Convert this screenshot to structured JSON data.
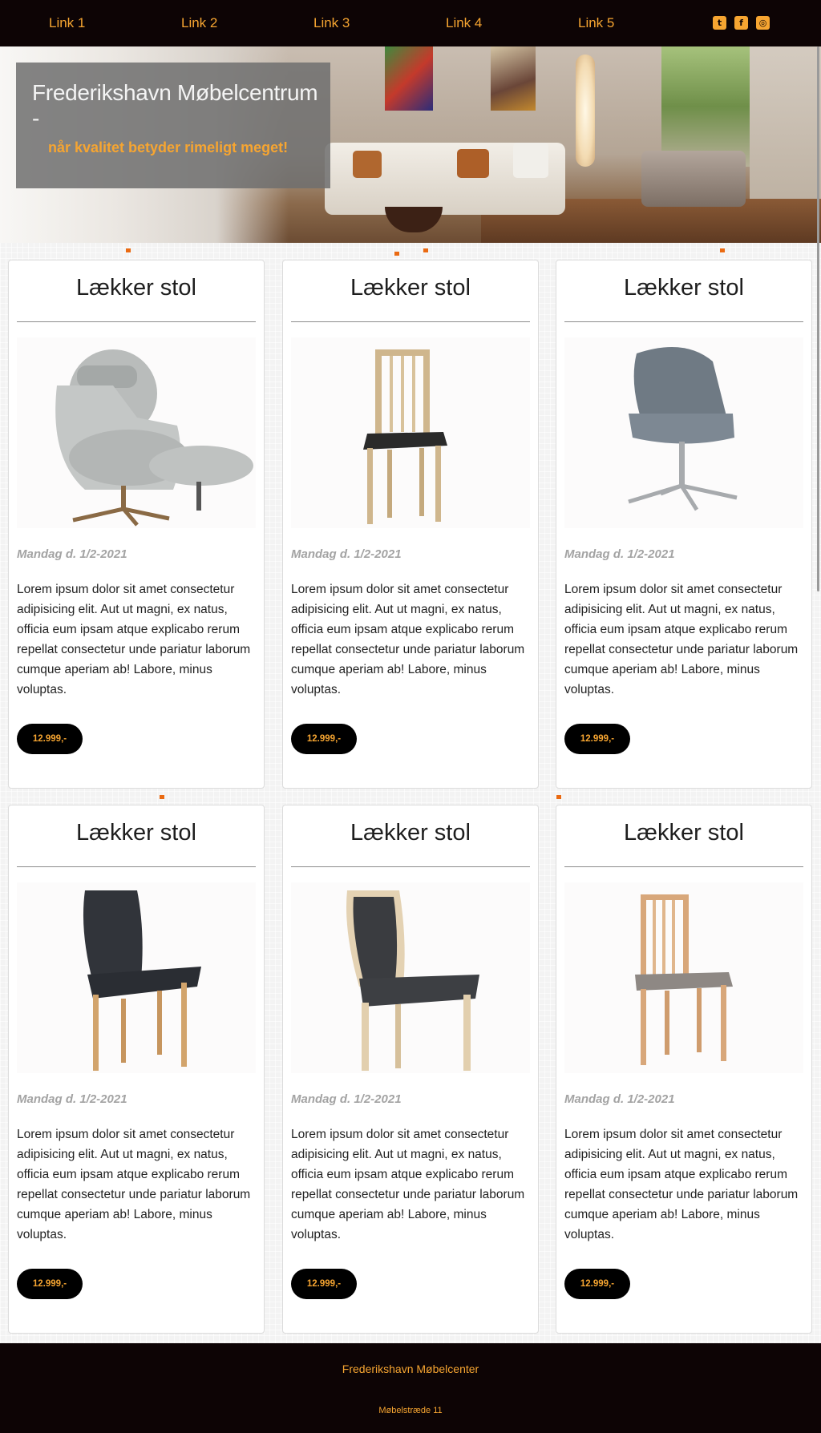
{
  "nav": {
    "links": [
      "Link 1",
      "Link 2",
      "Link 3",
      "Link 4",
      "Link 5"
    ],
    "social": [
      {
        "icon": "twitter-icon",
        "glyph": "t"
      },
      {
        "icon": "facebook-icon",
        "glyph": "f"
      },
      {
        "icon": "instagram-icon",
        "glyph": "◎"
      }
    ]
  },
  "hero": {
    "title": "Frederikshavn Møbelcentrum -",
    "subtitle": "når kvalitet betyder rimeligt meget!"
  },
  "products": [
    {
      "title": "Lækker stol",
      "image": "grey-wingback-armchair-with-footstool",
      "date": "Mandag d. 1/2-2021",
      "text": "Lorem ipsum dolor sit amet consectetur adipisicing elit. Aut ut magni, ex natus, officia eum ipsam atque explicabo rerum repellat consectetur unde pariatur laborum cumque aperiam ab! Labore, minus voluptas.",
      "price": "12.999,-"
    },
    {
      "title": "Lækker stol",
      "image": "oak-dining-chair-black-seat",
      "date": "Mandag d. 1/2-2021",
      "text": "Lorem ipsum dolor sit amet consectetur adipisicing elit. Aut ut magni, ex natus, officia eum ipsam atque explicabo rerum repellat consectetur unde pariatur laborum cumque aperiam ab! Labore, minus voluptas.",
      "price": "12.999,-"
    },
    {
      "title": "Lækker stol",
      "image": "grey-swivel-chair-chrome-base",
      "date": "Mandag d. 1/2-2021",
      "text": "Lorem ipsum dolor sit amet consectetur adipisicing elit. Aut ut magni, ex natus, officia eum ipsam atque explicabo rerum repellat consectetur unde pariatur laborum cumque aperiam ab! Labore, minus voluptas.",
      "price": "12.999,-"
    },
    {
      "title": "Lækker stol",
      "image": "black-leather-dining-chair",
      "date": "Mandag d. 1/2-2021",
      "text": "Lorem ipsum dolor sit amet consectetur adipisicing elit. Aut ut magni, ex natus, officia eum ipsam atque explicabo rerum repellat consectetur unde pariatur laborum cumque aperiam ab! Labore, minus voluptas.",
      "price": "12.999,-"
    },
    {
      "title": "Lækker stol",
      "image": "oak-chair-dark-upholstery",
      "date": "Mandag d. 1/2-2021",
      "text": "Lorem ipsum dolor sit amet consectetur adipisicing elit. Aut ut magni, ex natus, officia eum ipsam atque explicabo rerum repellat consectetur unde pariatur laborum cumque aperiam ab! Labore, minus voluptas.",
      "price": "12.999,-"
    },
    {
      "title": "Lækker stol",
      "image": "oak-spindle-back-chair",
      "date": "Mandag d. 1/2-2021",
      "text": "Lorem ipsum dolor sit amet consectetur adipisicing elit. Aut ut magni, ex natus, officia eum ipsam atque explicabo rerum repellat consectetur unde pariatur laborum cumque aperiam ab! Labore, minus voluptas.",
      "price": "12.999,-"
    }
  ],
  "footer": {
    "name": "Frederikshavn Møbelcenter",
    "address": "Møbelstræde 11"
  },
  "colors": {
    "nav_bg": "#0d0405",
    "accent": "#f6a531",
    "orange_dot": "#ea6a12",
    "button_bg": "#000000"
  }
}
